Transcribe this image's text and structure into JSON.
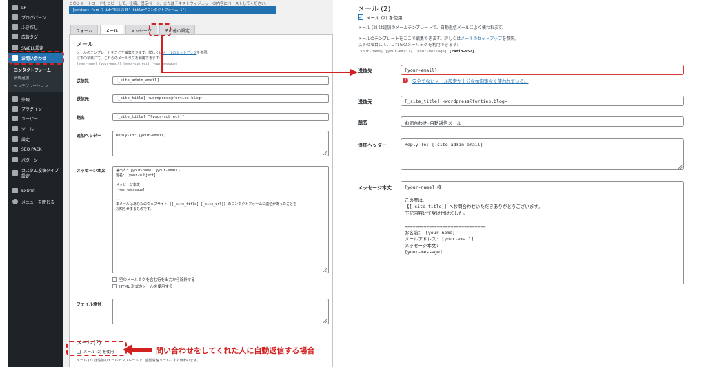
{
  "left_screen": {
    "sidebar": {
      "items": [
        {
          "label": "LP"
        },
        {
          "label": "ブログパーツ"
        },
        {
          "label": "ふきだし"
        },
        {
          "label": "広告タグ"
        },
        {
          "label": "SWELL設定"
        },
        {
          "label": "お問い合わせ"
        },
        {
          "label": "コンタクトフォーム"
        },
        {
          "label": "新規追加"
        },
        {
          "label": "インテグレーション"
        },
        {
          "label": "外観"
        },
        {
          "label": "プラグイン"
        },
        {
          "label": "ユーザー"
        },
        {
          "label": "ツール"
        },
        {
          "label": "設定"
        },
        {
          "label": "SEO PACK"
        },
        {
          "label": "パターン"
        },
        {
          "label": "カスタム投稿タイプ設定"
        },
        {
          "label": "ExUnit"
        },
        {
          "label": "メニューを閉じる"
        }
      ]
    },
    "hint": "このショートコードをコピーして、投稿、固定ページ、またはテキストウィジェットの内容にペーストしてください:",
    "shortcode": "[contact-form-7 id=\"5561545\" title=\"コンタクトフォーム 1\"]",
    "tabs": [
      {
        "label": "フォーム"
      },
      {
        "label": "メール"
      },
      {
        "label": "メッセージ"
      },
      {
        "label": "その他の設定"
      }
    ],
    "panel": {
      "title": "メール",
      "desc1_prefix": "メールのテンプレートをここで編集できます。詳しくは",
      "desc1_link": "メールのセットアップ",
      "desc1_suffix": "を参照。",
      "desc2": "以下の項目にて、これらのメールタグを利用できます:",
      "tags": "[your-name] [your-email] [your-subject] [your-message]",
      "fields": {
        "to_label": "送信先",
        "to_value": "[_site_admin_email]",
        "from_label": "送信元",
        "from_value": "[_site_title] <wordpress@forties.blog>",
        "subject_label": "題名",
        "subject_value": "[_site_title] \"[your-subject]\"",
        "headers_label": "追加ヘッダー",
        "headers_value": "Reply-To: [your-email]",
        "body_label": "メッセージ本文",
        "body_value": "差出人: [your-name] [your-email]\n題名: [your-subject]\n\nメッセージ本文:\n[your-message]\n\n--\n本メールはあなたのウェブサイト ([_site_title] [_site_url]) のコンタクトフォームに送信があったことを\nお知らせするものです。",
        "exclude_blank": "空のメールタグを含む行を出力から除外する",
        "use_html": "HTML 形式のメールを使用する",
        "attach_label": "ファイル添付"
      },
      "mail2_title": "メール (2)",
      "mail2_use": "メール (2) を使用",
      "mail2_desc": "メール (2) は追加のメールテンプレートで、自動返信メールによく使われます。"
    }
  },
  "right_screen": {
    "title": "メール (2)",
    "use_label": "メール (2) を使用",
    "desc1": "メール (2) は追加のメールテンプレートで、自動返信メールによく使われます。",
    "desc2_prefix": "メールのテンプレートをここで編集できます。詳しくは",
    "desc2_link": "メールのセットアップ",
    "desc2_suffix": "を参照。",
    "desc3": "以下の項目にて、これらのメールタグを利用できます:",
    "tags": "[your-name] [your-email] [your-message]",
    "tags_bold": "[radio-957]",
    "to_label": "送信先",
    "to_value": "[your-email]",
    "warning": "安全でないメール設定が十分な妨御策なく使われている。",
    "from_label": "送信元",
    "from_value": "[_site_title] <wordpress@forties.blog>",
    "subject_label": "題名",
    "subject_value": "お問合わせ−自動返信メール",
    "headers_label": "追加ヘッダー",
    "headers_value": "Reply-To: [_site_admin_email]",
    "body_label": "メッセージ本文",
    "body_value": "[your-name] 様\n\nこの度は、\n【[_site_title]】へお問合わせいただきありがとうございます。\n下記内容にて受け付けました。\n\n==============================\nお名前： [your-name]\nメールアドレス: [your-email]\nメッセージ本文:\n[your-message]"
  },
  "annotation": {
    "callout_text": "問い合わせをしてくれた人に自動返信する場合",
    "color": "#d32020"
  }
}
